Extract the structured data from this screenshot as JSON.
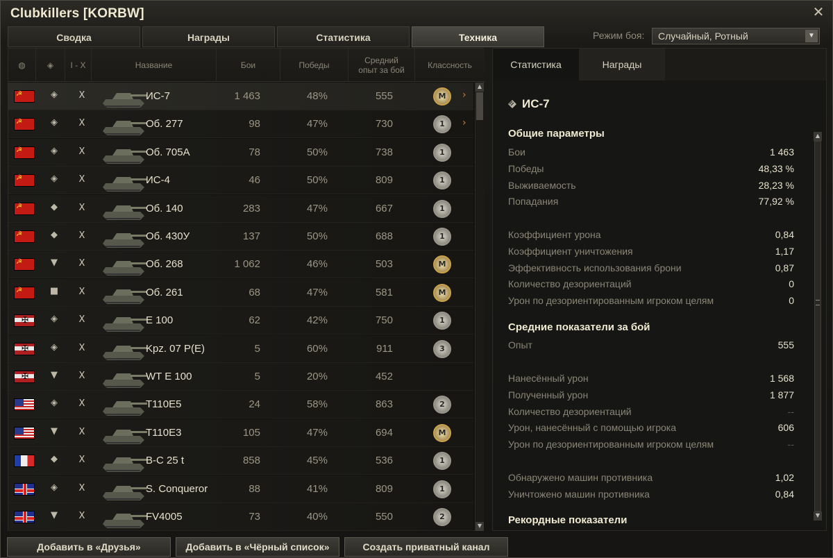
{
  "window": {
    "title": "Clubkillers [KORBW]"
  },
  "tabs": [
    "Сводка",
    "Награды",
    "Статистика",
    "Техника"
  ],
  "mode": {
    "label": "Режим боя:",
    "value": "Случайный, Ротный"
  },
  "table": {
    "headers": {
      "tier": "I - X",
      "name": "Название",
      "battles": "Бои",
      "wins": "Победы",
      "xp": "Средний опыт за бой",
      "mastery": "Классность"
    },
    "rows": [
      {
        "nation": "ussr",
        "cls": "heavy",
        "tier": "X",
        "name": "ИС-7",
        "battles": "1 463",
        "wins": "48%",
        "xp": "555",
        "badge": "M",
        "selected": true
      },
      {
        "nation": "ussr",
        "cls": "heavy",
        "tier": "X",
        "name": "Об. 277",
        "battles": "98",
        "wins": "47%",
        "xp": "730",
        "badge": "1"
      },
      {
        "nation": "ussr",
        "cls": "heavy",
        "tier": "X",
        "name": "Об. 705А",
        "battles": "78",
        "wins": "50%",
        "xp": "738",
        "badge": "1"
      },
      {
        "nation": "ussr",
        "cls": "heavy",
        "tier": "X",
        "name": "ИС-4",
        "battles": "46",
        "wins": "50%",
        "xp": "809",
        "badge": "1"
      },
      {
        "nation": "ussr",
        "cls": "medium",
        "tier": "X",
        "name": "Об. 140",
        "battles": "283",
        "wins": "47%",
        "xp": "667",
        "badge": "1"
      },
      {
        "nation": "ussr",
        "cls": "medium",
        "tier": "X",
        "name": "Об. 430У",
        "battles": "137",
        "wins": "50%",
        "xp": "688",
        "badge": "1"
      },
      {
        "nation": "ussr",
        "cls": "td",
        "tier": "X",
        "name": "Об. 268",
        "battles": "1 062",
        "wins": "46%",
        "xp": "503",
        "badge": "M"
      },
      {
        "nation": "ussr",
        "cls": "spg",
        "tier": "X",
        "name": "Об. 261",
        "battles": "68",
        "wins": "47%",
        "xp": "581",
        "badge": "M"
      },
      {
        "nation": "de",
        "cls": "heavy",
        "tier": "X",
        "name": "E 100",
        "battles": "62",
        "wins": "42%",
        "xp": "750",
        "badge": "1"
      },
      {
        "nation": "de",
        "cls": "heavy",
        "tier": "X",
        "name": "Kpz. 07 P(E)",
        "battles": "5",
        "wins": "60%",
        "xp": "911",
        "badge": "3"
      },
      {
        "nation": "de",
        "cls": "td",
        "tier": "X",
        "name": "WT E 100",
        "battles": "5",
        "wins": "20%",
        "xp": "452",
        "badge": ""
      },
      {
        "nation": "us",
        "cls": "heavy",
        "tier": "X",
        "name": "T110E5",
        "battles": "24",
        "wins": "58%",
        "xp": "863",
        "badge": "2"
      },
      {
        "nation": "us",
        "cls": "td",
        "tier": "X",
        "name": "T110E3",
        "battles": "105",
        "wins": "47%",
        "xp": "694",
        "badge": "M"
      },
      {
        "nation": "fr",
        "cls": "medium",
        "tier": "X",
        "name": "B-C 25 t",
        "battles": "858",
        "wins": "45%",
        "xp": "536",
        "badge": "1"
      },
      {
        "nation": "uk",
        "cls": "heavy",
        "tier": "X",
        "name": "S. Conqueror",
        "battles": "88",
        "wins": "41%",
        "xp": "809",
        "badge": "1"
      },
      {
        "nation": "uk",
        "cls": "td",
        "tier": "X",
        "name": "FV4005",
        "battles": "73",
        "wins": "40%",
        "xp": "550",
        "badge": "2"
      }
    ]
  },
  "details": {
    "tabs": [
      "Статистика",
      "Награды"
    ],
    "vehicle": "ИС-7",
    "general_title": "Общие параметры",
    "general": [
      {
        "label": "Бои",
        "value": "1 463"
      },
      {
        "label": "Победы",
        "value": "48,33 %"
      },
      {
        "label": "Выживаемость",
        "value": "28,23 %"
      },
      {
        "label": "Попадания",
        "value": "77,92 %"
      }
    ],
    "general2": [
      {
        "label": "Коэффициент урона",
        "value": "0,84"
      },
      {
        "label": "Коэффициент уничтожения",
        "value": "1,17"
      },
      {
        "label": "Эффективность использования брони",
        "value": "0,87"
      },
      {
        "label": "Количество дезориентаций",
        "value": "0"
      },
      {
        "label": "Урон по дезориентированным игроком целям",
        "value": "0"
      }
    ],
    "avg_title": "Средние показатели за бой",
    "avg": [
      {
        "label": "Опыт",
        "value": "555"
      }
    ],
    "avg2": [
      {
        "label": "Нанесённый урон",
        "value": "1 568"
      },
      {
        "label": "Полученный урон",
        "value": "1 877"
      },
      {
        "label": "Количество дезориентаций",
        "value": "--"
      },
      {
        "label": "Урон, нанесённый с помощью игрока",
        "value": "606"
      },
      {
        "label": "Урон по дезориентированным игроком целям",
        "value": "--"
      }
    ],
    "avg3": [
      {
        "label": "Обнаружено машин противника",
        "value": "1,02"
      },
      {
        "label": "Уничтожено машин противника",
        "value": "0,84"
      }
    ],
    "records_title": "Рекордные показатели"
  },
  "buttons": {
    "add_friend": "Добавить в «Друзья»",
    "add_blacklist": "Добавить в «Чёрный список»",
    "private_channel": "Создать приватный канал"
  }
}
